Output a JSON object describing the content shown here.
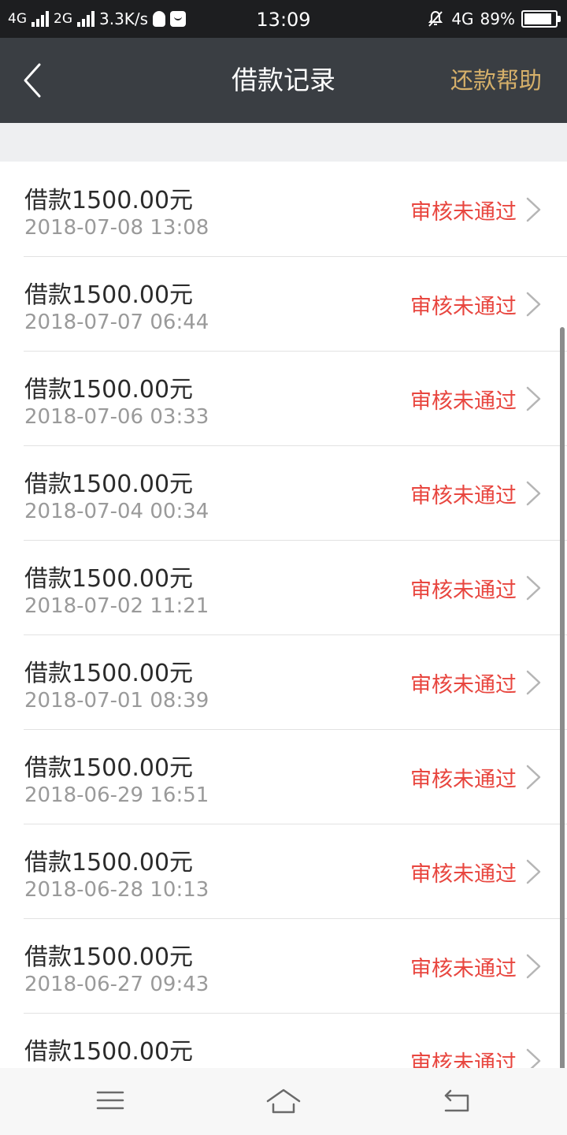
{
  "status_bar": {
    "net1": "4G",
    "net2": "2G",
    "speed": "3.3K/s",
    "time": "13:09",
    "net3": "4G",
    "battery": "89%",
    "battery_level": 0.89
  },
  "header": {
    "title": "借款记录",
    "help": "还款帮助",
    "accent_color": "#d6b06a",
    "background_color": "#3a3e43"
  },
  "records": [
    {
      "amount": "借款1500.00元",
      "date": "2018-07-08 13:08",
      "status": "审核未通过"
    },
    {
      "amount": "借款1500.00元",
      "date": "2018-07-07 06:44",
      "status": "审核未通过"
    },
    {
      "amount": "借款1500.00元",
      "date": "2018-07-06 03:33",
      "status": "审核未通过"
    },
    {
      "amount": "借款1500.00元",
      "date": "2018-07-04 00:34",
      "status": "审核未通过"
    },
    {
      "amount": "借款1500.00元",
      "date": "2018-07-02 11:21",
      "status": "审核未通过"
    },
    {
      "amount": "借款1500.00元",
      "date": "2018-07-01 08:39",
      "status": "审核未通过"
    },
    {
      "amount": "借款1500.00元",
      "date": "2018-06-29 16:51",
      "status": "审核未通过"
    },
    {
      "amount": "借款1500.00元",
      "date": "2018-06-28 10:13",
      "status": "审核未通过"
    },
    {
      "amount": "借款1500.00元",
      "date": "2018-06-27 09:43",
      "status": "审核未通过"
    },
    {
      "amount": "借款1500.00元",
      "date": "",
      "status": "审核未通过"
    }
  ],
  "status_color": "#e8463f",
  "icons": {
    "back": "chevron-left-icon",
    "row_arrow": "chevron-right-icon",
    "nav_menu": "menu-icon",
    "nav_home": "home-icon",
    "nav_back": "back-icon"
  }
}
